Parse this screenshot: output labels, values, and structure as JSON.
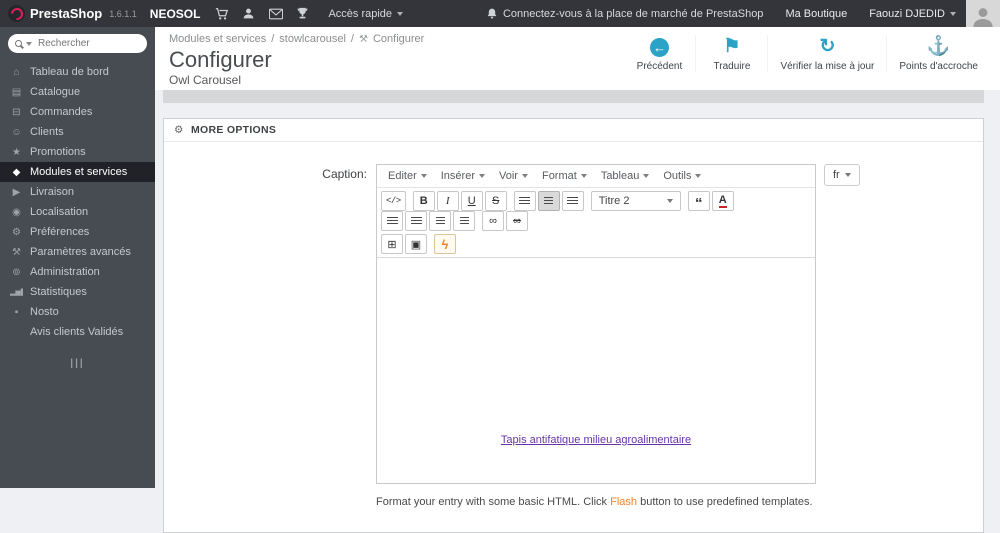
{
  "colors": {
    "accent": "#2ba3c6",
    "flash_orange": "#f5812a",
    "link_purple": "#6633aa"
  },
  "topbar": {
    "brand_presta": "Presta",
    "brand_shop": "Shop",
    "version": "1.6.1.1",
    "shop_name": "NEOSOL",
    "quick_access": "Accès rapide",
    "marketplace_text": "Connectez-vous à la place de marché de PrestaShop",
    "my_shop": "Ma Boutique",
    "user_name": "Faouzi DJEDID"
  },
  "sidebar": {
    "search_placeholder": "Rechercher",
    "items": [
      {
        "label": "Tableau de bord",
        "glyph": "⌂"
      },
      {
        "label": "Catalogue",
        "glyph": "▤"
      },
      {
        "label": "Commandes",
        "glyph": "⊟"
      },
      {
        "label": "Clients",
        "glyph": "☺"
      },
      {
        "label": "Promotions",
        "glyph": "★"
      },
      {
        "label": "Modules et services",
        "glyph": "◆"
      },
      {
        "label": "Livraison",
        "glyph": "▶"
      },
      {
        "label": "Localisation",
        "glyph": "◉"
      },
      {
        "label": "Préférences",
        "glyph": "⚙"
      },
      {
        "label": "Paramètres avancés",
        "glyph": "⚒"
      },
      {
        "label": "Administration",
        "glyph": "⊚"
      },
      {
        "label": "Statistiques",
        "glyph": "▂▅▇"
      },
      {
        "label": "Nosto",
        "glyph": "▪"
      },
      {
        "label": "Avis clients Validés",
        "glyph": ""
      }
    ],
    "collapse_glyph": "|||"
  },
  "header": {
    "breadcrumb": {
      "item1": "Modules et services",
      "item2": "stowlcarousel",
      "item3": "Configurer",
      "separator": "/",
      "config_glyph": "⚒"
    },
    "title": "Configurer",
    "subtitle": "Owl Carousel",
    "actions": [
      {
        "label": "Précédent",
        "glyph": "←"
      },
      {
        "label": "Traduire",
        "glyph": "⚑"
      },
      {
        "label": "Vérifier la mise à jour",
        "glyph": "↻"
      },
      {
        "label": "Points d'accroche",
        "glyph": "⚓"
      }
    ]
  },
  "panel": {
    "header_glyph": "⚙",
    "title": "MORE OPTIONS",
    "caption_label": "Caption:",
    "lang_button": "fr",
    "editor": {
      "menus": [
        {
          "label": "Editer"
        },
        {
          "label": "Insérer"
        },
        {
          "label": "Voir"
        },
        {
          "label": "Format"
        },
        {
          "label": "Tableau"
        },
        {
          "label": "Outils"
        }
      ],
      "toolbar": {
        "code": "</>",
        "bold": "B",
        "italic": "I",
        "underline": "U",
        "strike": "S",
        "format_select": "Titre 2",
        "quote": "“",
        "color": "A",
        "link": "∞",
        "unlink": "∞",
        "table": "⊞",
        "image": "▣",
        "flash": "ϟ"
      },
      "content_link": "Tapis antifatique milieu agroalimentaire"
    },
    "help": {
      "before": "Format your entry with some basic HTML. Click ",
      "flash": "Flash",
      "after": " button to use predefined templates."
    }
  }
}
